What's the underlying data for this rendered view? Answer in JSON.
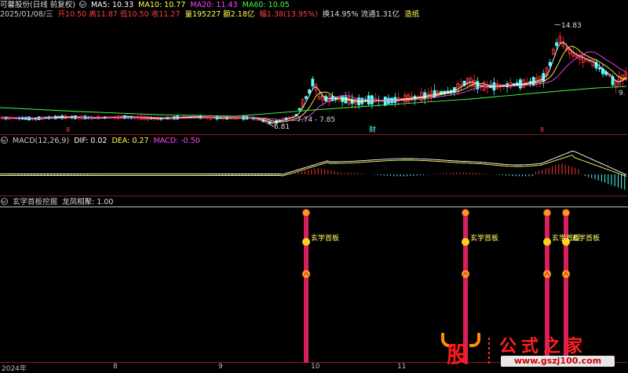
{
  "header": {
    "stock_name": "可馨股份(日线 前复权)",
    "ma5": "MA5: 10.33",
    "ma10": "MA10: 10.77",
    "ma20": "MA20: 11.43",
    "ma60": "MA60: 10.05",
    "date": "2025/01/08/三",
    "open": "开10.50",
    "high": "高11.87",
    "low": "低10.50",
    "close": "收11.27",
    "volume": "量195227",
    "amount": "额2.18亿",
    "change": "幅1.38(13.95%)",
    "turnover": "换14.95%",
    "float": "流通1.31亿",
    "concept": "造纸"
  },
  "colors": {
    "ma5": "#ffffff",
    "ma10": "#ffff55",
    "ma20": "#ff44ff",
    "ma60": "#44ff44",
    "up": "#ff3232",
    "down": "#54ffff",
    "pillar": "#d81e5b"
  },
  "price_labels": {
    "high": "14.83",
    "low": "6.81",
    "range": "7.74 - 7.85",
    "right_edge": "9."
  },
  "event_marks": {
    "mark1": "8",
    "mark2": "财",
    "mark3": "8"
  },
  "macd": {
    "title": "MACD(12,26,9)",
    "dif": "DIF: 0.02",
    "dea": "DEA: 0.27",
    "macd": "MACD: -0.50"
  },
  "indicator": {
    "title": "玄学首板挖掘",
    "value_label": "龙凤相聚: 1.00",
    "signal_label": "玄学首板"
  },
  "x_axis": [
    "2024年",
    "8",
    "9",
    "10",
    "11"
  ],
  "watermark": {
    "char": "股",
    "name": "公式之家",
    "url": "www.gszj100.com"
  }
}
